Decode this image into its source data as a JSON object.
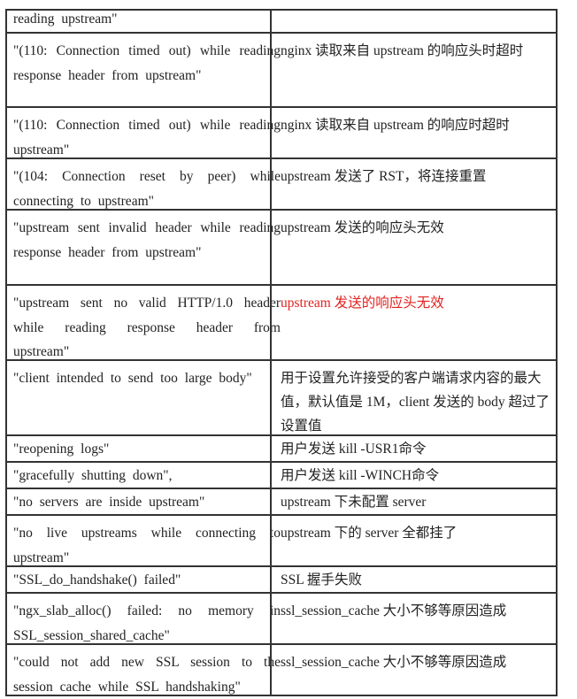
{
  "rows": [
    {
      "msg": "reading upstream\"",
      "desc": ""
    },
    {
      "msg": "\"(110: Connection timed out) while reading response header from upstream\"",
      "desc": "nginx 读取来自 upstream 的响应头时超时"
    },
    {
      "msg": "\"(110: Connection timed out) while reading upstream\"",
      "desc": "nginx 读取来自 upstream 的响应时超时"
    },
    {
      "msg": "\"(104: Connection reset by peer) while connecting to upstream\"",
      "desc": "upstream 发送了 RST，将连接重置"
    },
    {
      "msg": "\"upstream sent invalid header while reading response header from upstream\"",
      "desc": "upstream 发送的响应头无效"
    },
    {
      "msg": "\"upstream sent no valid HTTP/1.0 header while reading response header from upstream\"",
      "desc": "upstream 发送的响应头无效"
    },
    {
      "msg": "\"client intended to send too large body\"",
      "desc": "用于设置允许接受的客户端请求内容的最大值，默认值是 1M，client 发送的 body 超过了设置值"
    },
    {
      "msg": "\"reopening logs\"",
      "desc": "用户发送 kill -USR1命令"
    },
    {
      "msg": "\"gracefully shutting down\",",
      "desc": "用户发送 kill -WINCH命令"
    },
    {
      "msg": "\"no servers are inside upstream\"",
      "desc": "upstream 下未配置 server"
    },
    {
      "msg": "\"no live upstreams while connecting to upstream\"",
      "desc": "upstream 下的 server 全都挂了"
    },
    {
      "msg": "\"SSL_do_handshake() failed\"",
      "desc": "SSL 握手失败"
    },
    {
      "msg": "\"ngx_slab_alloc() failed: no memory in SSL_session_shared_cache\"",
      "desc": "ssl_session_cache 大小不够等原因造成"
    },
    {
      "msg": "\"could not add new SSL session to the session cache while SSL handshaking\"",
      "desc": "ssl_session_cache 大小不够等原因造成"
    }
  ],
  "colors": {
    "border": "#333333",
    "text": "#222222",
    "highlight": "#e0231f"
  }
}
